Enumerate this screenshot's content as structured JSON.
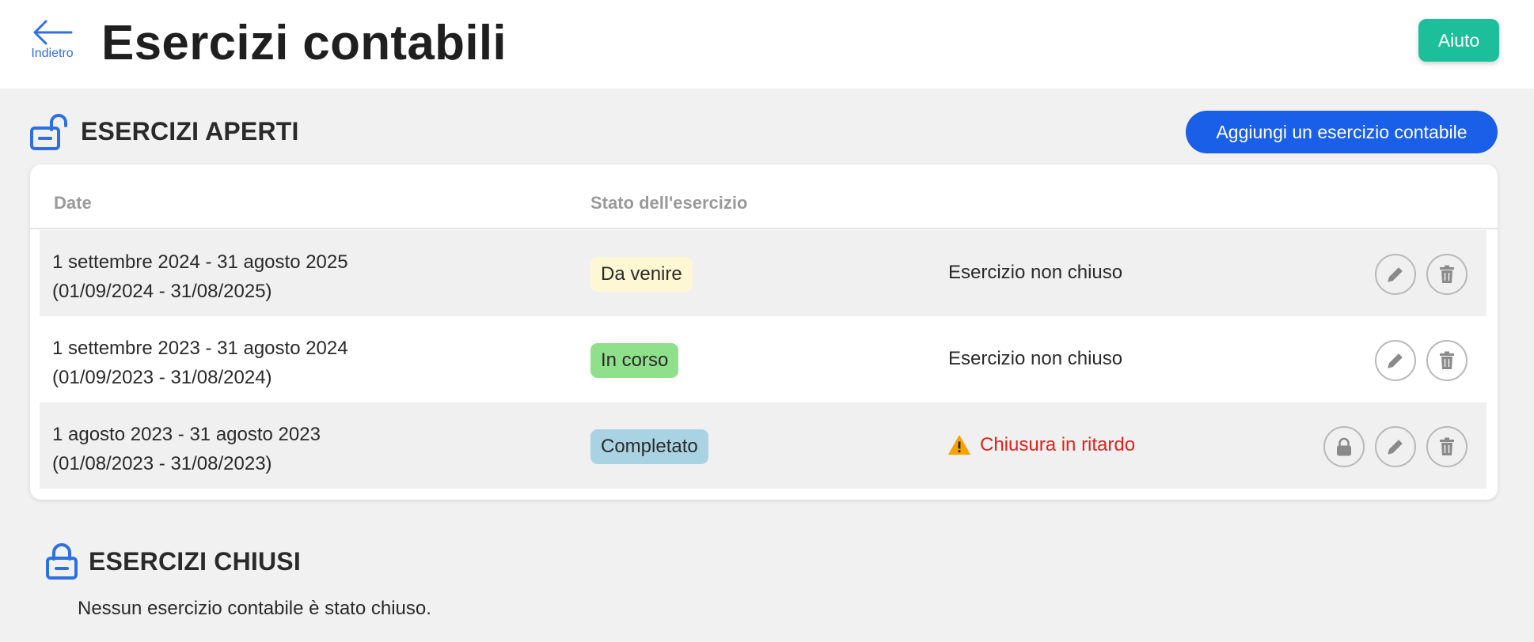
{
  "header": {
    "back_label": "Indietro",
    "title": "Esercizi contabili",
    "help_label": "Aiuto"
  },
  "open_section": {
    "title": "ESERCIZI APERTI",
    "add_label": "Aggiungi un esercizio contabile",
    "columns": [
      "Date",
      "Stato dell'esercizio"
    ],
    "rows": [
      {
        "date_long": "1 settembre 2024 - 31 agosto 2025",
        "date_short": "(01/09/2024 - 31/08/2025)",
        "badge": "Da venire",
        "badge_color": "#fdf8d3",
        "status": "Esercizio non chiuso"
      },
      {
        "date_long": "1 settembre 2023 - 31 agosto 2024",
        "date_short": "(01/09/2023 - 31/08/2024)",
        "badge": "In corso",
        "badge_color": "#8ee08a",
        "status": "Esercizio non chiuso"
      },
      {
        "date_long": "1 agosto 2023 - 31 agosto 2023",
        "date_short": "(01/08/2023 - 31/08/2023)",
        "badge": "Completato",
        "badge_color": "#a9d3e3",
        "status": "Chiusura in ritardo",
        "status_color": "#e0231d"
      }
    ]
  },
  "closed_section": {
    "title": "ESERCIZI CHIUSI",
    "empty_message": "Nessun esercizio contabile è stato chiuso."
  },
  "colors": {
    "primary": "#1a5fe8",
    "help": "#1cbf9a",
    "warning": "#f5a300",
    "icon_blue": "#2f6fe0"
  }
}
